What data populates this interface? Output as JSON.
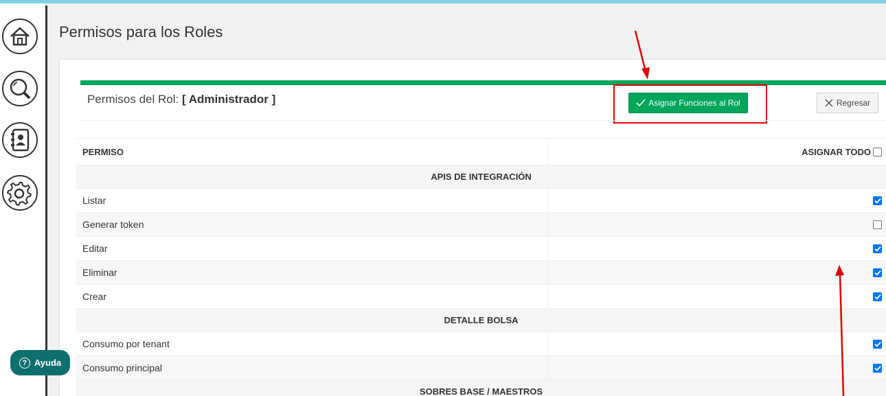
{
  "page": {
    "title": "Permisos para los Roles"
  },
  "sidebar": {
    "items": [
      {
        "icon": "home-icon"
      },
      {
        "icon": "search-icon"
      },
      {
        "icon": "contacts-icon"
      },
      {
        "icon": "gear-icon"
      }
    ],
    "help_label": "Ayuda"
  },
  "role_header": {
    "prefix": "Permisos del Rol:",
    "role_name": "[ Administrador ]",
    "assign_label": "Asignar Funciones al Rol",
    "back_label": "Regresar"
  },
  "table": {
    "col_permission": "PERMISO",
    "col_assign_all": "ASIGNAR TODO",
    "assign_all_checked": false,
    "sections": [
      {
        "title": "APIS DE INTEGRACIÓN",
        "rows": [
          {
            "name": "Listar",
            "checked": true
          },
          {
            "name": "Generar token",
            "checked": false
          },
          {
            "name": "Editar",
            "checked": true
          },
          {
            "name": "Eliminar",
            "checked": true
          },
          {
            "name": "Crear",
            "checked": true
          }
        ]
      },
      {
        "title": "DETALLE BOLSA",
        "rows": [
          {
            "name": "Consumo por tenant",
            "checked": true
          },
          {
            "name": "Consumo principal",
            "checked": true
          }
        ]
      },
      {
        "title": "SOBRES BASE / MAESTROS",
        "rows": []
      }
    ]
  },
  "colors": {
    "accent_green": "#00a65a",
    "help_teal": "#0f6e6e",
    "annotation_red": "#e00000",
    "checkbox_blue": "#0075ff"
  }
}
